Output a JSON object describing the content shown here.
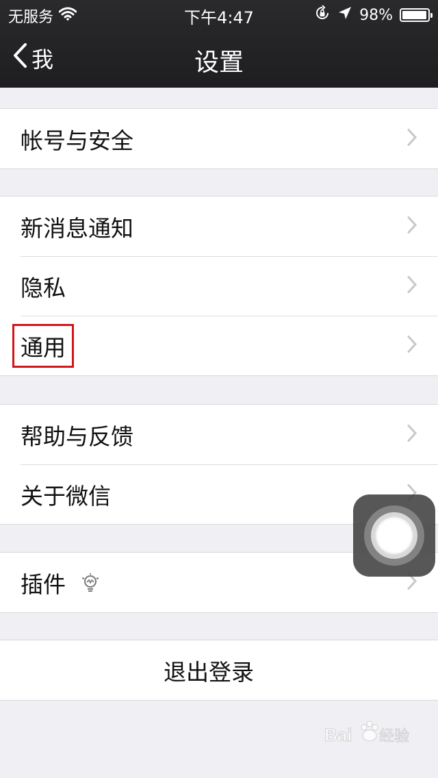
{
  "status_bar": {
    "carrier": "无服务",
    "time": "下午4:47",
    "battery_text": "98%",
    "battery_level": 0.98
  },
  "nav": {
    "back_label": "我",
    "title": "设置"
  },
  "sections": {
    "account": {
      "label": "帐号与安全"
    },
    "notifications": {
      "label": "新消息通知"
    },
    "privacy": {
      "label": "隐私"
    },
    "general": {
      "label": "通用"
    },
    "help": {
      "label": "帮助与反馈"
    },
    "about": {
      "label": "关于微信"
    },
    "plugins": {
      "label": "插件"
    },
    "logout": {
      "label": "退出登录"
    }
  },
  "icons": {
    "back": "chevron-left-icon",
    "disclosure": "chevron-right-icon",
    "plugin_badge": "lightbulb-icon"
  },
  "colors": {
    "nav_background": "#1e1e20",
    "list_background": "#ffffff",
    "page_background": "#efeff4",
    "highlight": "#d0151b"
  }
}
